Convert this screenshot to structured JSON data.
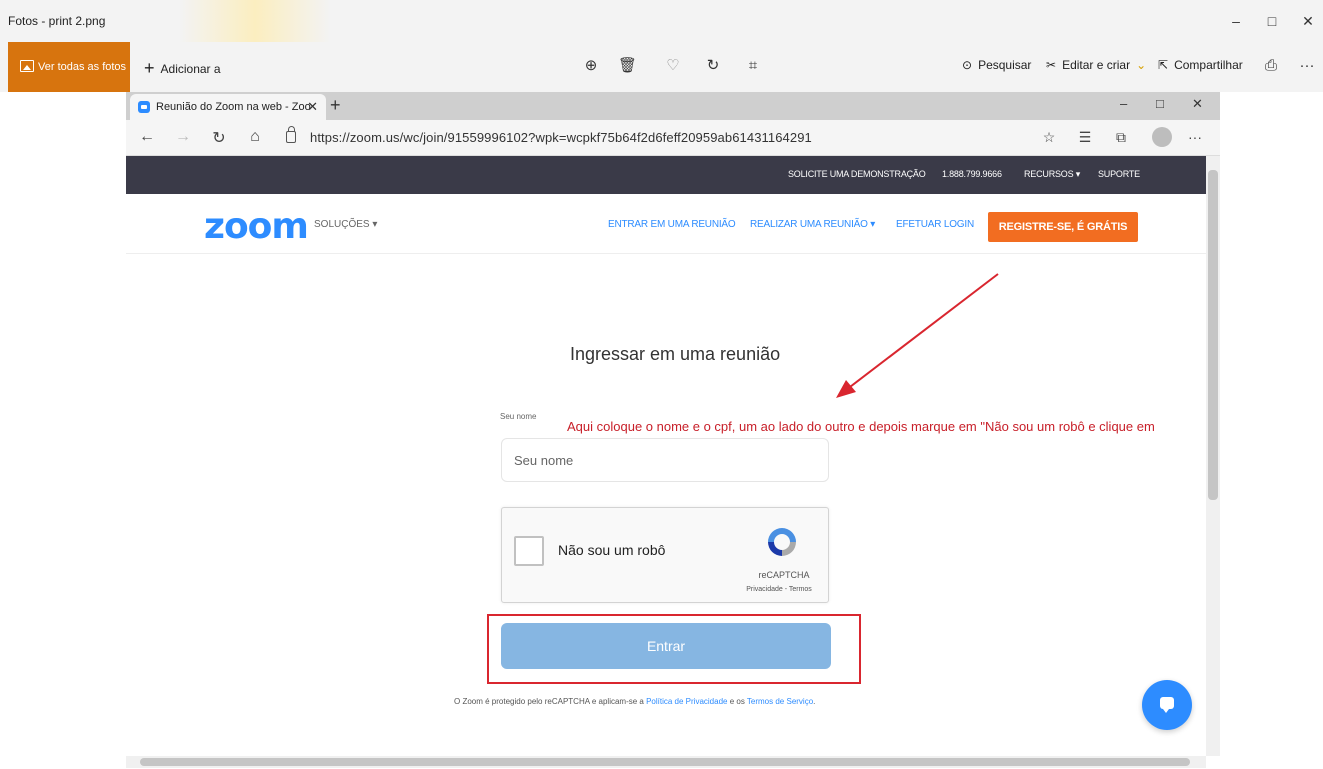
{
  "photos_app": {
    "title": "Fotos - print 2.png",
    "window_controls": {
      "minimize": "–",
      "maximize": "□",
      "close": "✕"
    },
    "toolbar": {
      "all_photos": "Ver todas as fotos",
      "add_to": "Adicionar a",
      "add_icon": "+",
      "zoom_icon": "⊕",
      "delete_icon": "🗑",
      "favorite_icon": "♡",
      "rotate_icon": "↻",
      "crop_icon": "⌗",
      "search": "Pesquisar",
      "search_icon": "⊙",
      "edit_create": "Editar e criar",
      "edit_icon": "✂",
      "edit_chevron": "⌄",
      "share": "Compartilhar",
      "share_icon": "⇱",
      "print_icon": "⎙",
      "more_icon": "···"
    }
  },
  "browser": {
    "tab_title": "Reunião do Zoom na web - Zoo",
    "tab_close": "✕",
    "new_tab": "+",
    "window_controls": {
      "minimize": "–",
      "maximize": "□",
      "close": "✕"
    },
    "nav": {
      "back": "←",
      "forward": "→",
      "refresh": "↻",
      "home": "⌂"
    },
    "url": "https://zoom.us/wc/join/91559996102?wpk=wcpkf75b64f2d6feff20959ab61431164291",
    "right_icons": {
      "favorite": "☆",
      "favorites_list": "☰",
      "collections": "⧉",
      "more": "···"
    }
  },
  "zoom_page": {
    "topnav": {
      "demo": "SOLICITE UMA DEMONSTRAÇÃO",
      "phone": "1.888.799.9666",
      "resources": "RECURSOS ▾",
      "support": "SUPORTE"
    },
    "logo": "zoom",
    "solutions": "SOLUÇÕES ▾",
    "mainnav": {
      "join": "ENTRAR EM UMA REUNIÃO",
      "host": "REALIZAR UMA REUNIÃO ▾",
      "login": "EFETUAR LOGIN",
      "signup": "REGISTRE-SE, É GRÁTIS"
    },
    "heading": "Ingressar em uma reunião",
    "name_label": "Seu nome",
    "name_placeholder": "Seu nome",
    "recaptcha": {
      "label": "Não sou um robô",
      "brand": "reCAPTCHA",
      "links": "Privacidade - Termos"
    },
    "join_button": "Entrar",
    "footer": {
      "prefix": "O Zoom é protegido pelo reCAPTCHA e aplicam-se a ",
      "privacy": "Política de Privacidade",
      "middle": " e os ",
      "terms": "Termos de Serviço",
      "suffix": "."
    }
  },
  "annotation": {
    "text": "Aqui coloque o nome e o cpf, um ao lado do outro e depois marque em \"Não sou um robô e clique em",
    "color": "#c8202a"
  },
  "colors": {
    "zoom_blue": "#2d8cff",
    "signup_orange": "#f26d21",
    "photos_accent": "#d7740e",
    "highlight_red": "#d9262f",
    "join_button": "#86b6e2"
  }
}
